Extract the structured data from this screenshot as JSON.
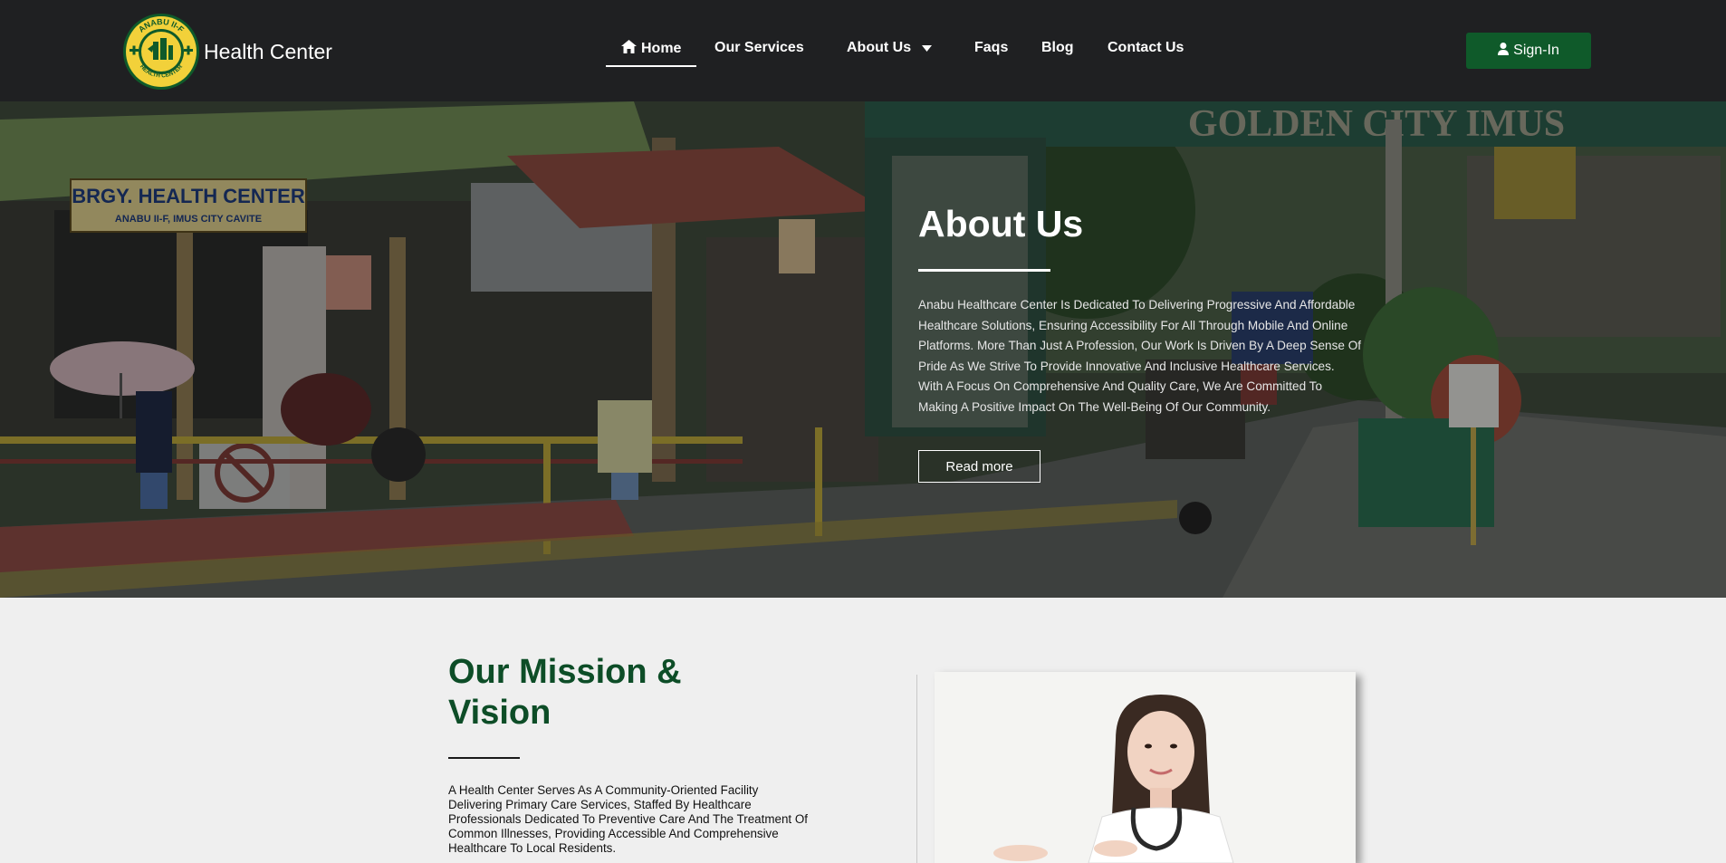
{
  "brand": {
    "name": "Health Center",
    "seal_top_text": "ANABU II-F",
    "seal_bottom_text": "HEALTH CENTER"
  },
  "nav": {
    "home": "Home",
    "services": "Our Services",
    "about": "About Us",
    "faqs": "Faqs",
    "blog": "Blog",
    "contact": "Contact Us",
    "signin": "Sign-In"
  },
  "hero": {
    "title": "About Us",
    "description": "Anabu Healthcare Center Is Dedicated To Delivering Progressive And Affordable Healthcare Solutions, Ensuring Accessibility For All Through Mobile And Online Platforms. More Than Just A Profession, Our Work Is Driven By A Deep Sense Of Pride As We Strive To Provide Innovative And Inclusive Healthcare Services. With A Focus On Comprehensive And Quality Care, We Are Committed To Making A Positive Impact On The Well-Being Of Our Community.",
    "read_more": "Read more",
    "sign_text_1": "BRGY. HEALTH CENTER",
    "sign_text_2": "ANABU II-F, IMUS CITY CAVITE",
    "arch_text": "GOLDEN CITY IMUS"
  },
  "mission": {
    "title": "Our Mission & Vision",
    "description": "A Health Center Serves As A Community-Oriented Facility Delivering Primary Care Services, Staffed By Healthcare Professionals Dedicated To Preventive Care And The Treatment Of Common Illnesses, Providing Accessible And Comprehensive Healthcare To Local Residents."
  },
  "colors": {
    "navbar": "#1f2022",
    "brand_green": "#0f5a2a",
    "heading_green": "#0d4d27"
  },
  "icons": {
    "home": "home-icon",
    "dropdown": "caret-down-icon",
    "user": "user-icon"
  }
}
